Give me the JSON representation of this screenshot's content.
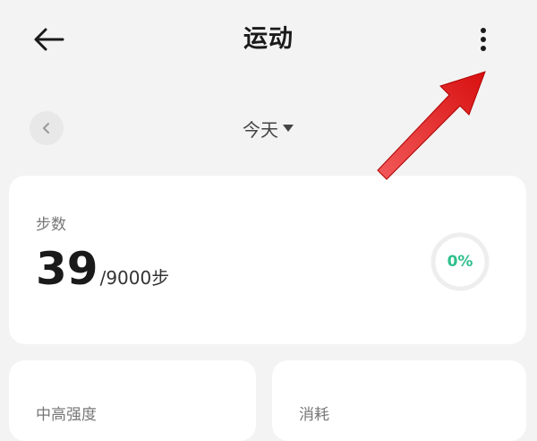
{
  "header": {
    "title": "运动",
    "back_icon": "arrow-left-icon",
    "more_icon": "more-vertical-icon"
  },
  "date_nav": {
    "prev_icon": "chevron-left-icon",
    "selected": "今天",
    "dropdown_icon": "caret-down-icon"
  },
  "steps_card": {
    "title": "步数",
    "value": "39",
    "goal": "/9000",
    "unit": "步",
    "progress_percent": 0,
    "progress_label": "0%"
  },
  "cards": [
    {
      "title": "中高强度"
    },
    {
      "title": "消耗"
    }
  ],
  "colors": {
    "accent": "#2fbf8d",
    "background": "#f3f3f3",
    "card": "#ffffff",
    "annotation_arrow": "#e52020"
  }
}
